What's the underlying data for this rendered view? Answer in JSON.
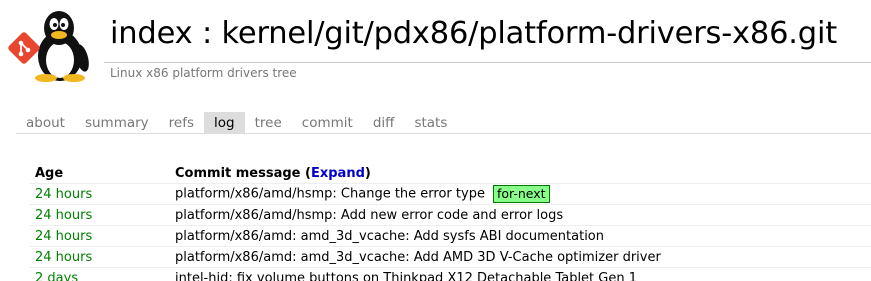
{
  "header": {
    "title": "index : kernel/git/pdx86/platform-drivers-x86.git",
    "description": "Linux x86 platform drivers tree"
  },
  "logo": {
    "icon": "git-tux-logo",
    "accent_color": "#e8462e"
  },
  "tabs": [
    {
      "label": "about",
      "active": false
    },
    {
      "label": "summary",
      "active": false
    },
    {
      "label": "refs",
      "active": false
    },
    {
      "label": "log",
      "active": true
    },
    {
      "label": "tree",
      "active": false
    },
    {
      "label": "commit",
      "active": false
    },
    {
      "label": "diff",
      "active": false
    },
    {
      "label": "stats",
      "active": false
    }
  ],
  "log": {
    "col_age": "Age",
    "col_message_prefix": "Commit message (",
    "col_message_link": "Expand",
    "col_message_suffix": ")",
    "rows": [
      {
        "age": "24 hours",
        "message": "platform/x86/amd/hsmp: Change the error type",
        "decoration": "for-next"
      },
      {
        "age": "24 hours",
        "message": "platform/x86/amd/hsmp: Add new error code and error logs"
      },
      {
        "age": "24 hours",
        "message": "platform/x86/amd: amd_3d_vcache: Add sysfs ABI documentation"
      },
      {
        "age": "24 hours",
        "message": "platform/x86/amd: amd_3d_vcache: Add AMD 3D V-Cache optimizer driver"
      },
      {
        "age": "2 days",
        "message": "intel-hid: fix volume buttons on Thinkpad X12 Detachable Tablet Gen 1"
      }
    ]
  },
  "colors": {
    "age": "#008000",
    "link": "#0000cc",
    "decoration_bg": "#88ff88",
    "decoration_border": "#007700",
    "active_tab_bg": "#dddddd"
  }
}
